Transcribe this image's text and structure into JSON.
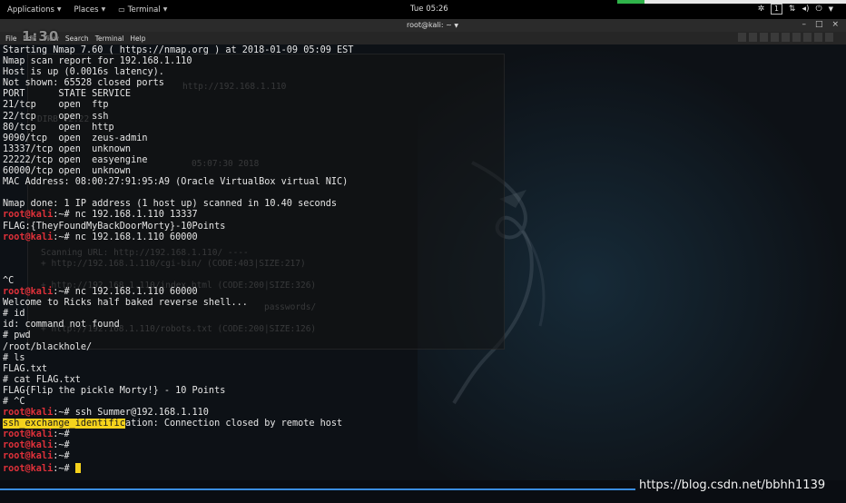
{
  "topbar": {
    "menus": [
      "Applications",
      "Places",
      "Terminal"
    ],
    "clock": "Tue 05:26",
    "workspace": "1"
  },
  "titlebar": {
    "title": "root@kali: ~"
  },
  "menubar": {
    "items": [
      "File",
      "Edit",
      "View",
      "Search",
      "Terminal",
      "Help"
    ]
  },
  "timer": "1:30",
  "terminal": {
    "lines": [
      {
        "text": "Starting Nmap 7.60 ( https://nmap.org ) at 2018-01-09 05:09 EST"
      },
      {
        "text": "Nmap scan report for 192.168.1.110"
      },
      {
        "text": "Host is up (0.0016s latency)."
      },
      {
        "text": "Not shown: 65528 closed ports"
      },
      {
        "text": "PORT      STATE SERVICE"
      },
      {
        "text": "21/tcp    open  ftp"
      },
      {
        "text": "22/tcp    open  ssh"
      },
      {
        "text": "80/tcp    open  http"
      },
      {
        "text": "9090/tcp  open  zeus-admin"
      },
      {
        "text": "13337/tcp open  unknown"
      },
      {
        "text": "22222/tcp open  easyengine"
      },
      {
        "text": "60000/tcp open  unknown"
      },
      {
        "text": "MAC Address: 08:00:27:91:95:A9 (Oracle VirtualBox virtual NIC)"
      },
      {
        "text": ""
      },
      {
        "text": "Nmap done: 1 IP address (1 host up) scanned in 10.40 seconds"
      },
      {
        "prompt": "root@kali",
        "text": ":~# nc 192.168.1.110 13337"
      },
      {
        "text": "FLAG:{TheyFoundMyBackDoorMorty}-10Points"
      },
      {
        "prompt": "root@kali",
        "text": ":~# nc 192.168.1.110 60000"
      },
      {
        "text": ""
      },
      {
        "text": ""
      },
      {
        "text": ""
      },
      {
        "text": "^C"
      },
      {
        "prompt": "root@kali",
        "text": ":~# nc 192.168.1.110 60000"
      },
      {
        "text": "Welcome to Ricks half baked reverse shell..."
      },
      {
        "text": "# id"
      },
      {
        "text": "id: command not found"
      },
      {
        "text": "# pwd"
      },
      {
        "text": "/root/blackhole/"
      },
      {
        "text": "# ls"
      },
      {
        "text": "FLAG.txt"
      },
      {
        "text": "# cat FLAG.txt"
      },
      {
        "text": "FLAG{Flip the pickle Morty!} - 10 Points"
      },
      {
        "text": "# ^C"
      },
      {
        "prompt": "root@kali",
        "text": ":~# ssh Summer@192.168.1.110"
      },
      {
        "highlight": "ssh_exchange_identific",
        "text": "ation: Connection closed by remote host"
      },
      {
        "prompt": "root@kali",
        "text": ":~#"
      },
      {
        "prompt": "root@kali",
        "text": ":~#"
      },
      {
        "prompt": "root@kali",
        "text": ":~#"
      },
      {
        "prompt": "root@kali",
        "text": ":~# ",
        "cursor": true
      }
    ]
  },
  "ghost_text": [
    "http://192.168.1.110",
    "DIRB v2.22",
    "05:07:30 2018",
    "Scanning URL: http://192.168.1.110/ ----",
    "+ http://192.168.1.110/cgi-bin/ (CODE:403|SIZE:217)",
    "+ http://192.168.1.110/index.html (CODE:200|SIZE:326)",
    "passwords/",
    "+ http://192.168.1.110/robots.txt (CODE:200|SIZE:126)"
  ],
  "watermark": "https://blog.csdn.net/bbhh1139",
  "colors": {
    "prompt": "#e0313a",
    "highlight": "#f5d21c",
    "terminal_bg": "#0d1116",
    "accent_line": "#3a8de0"
  }
}
